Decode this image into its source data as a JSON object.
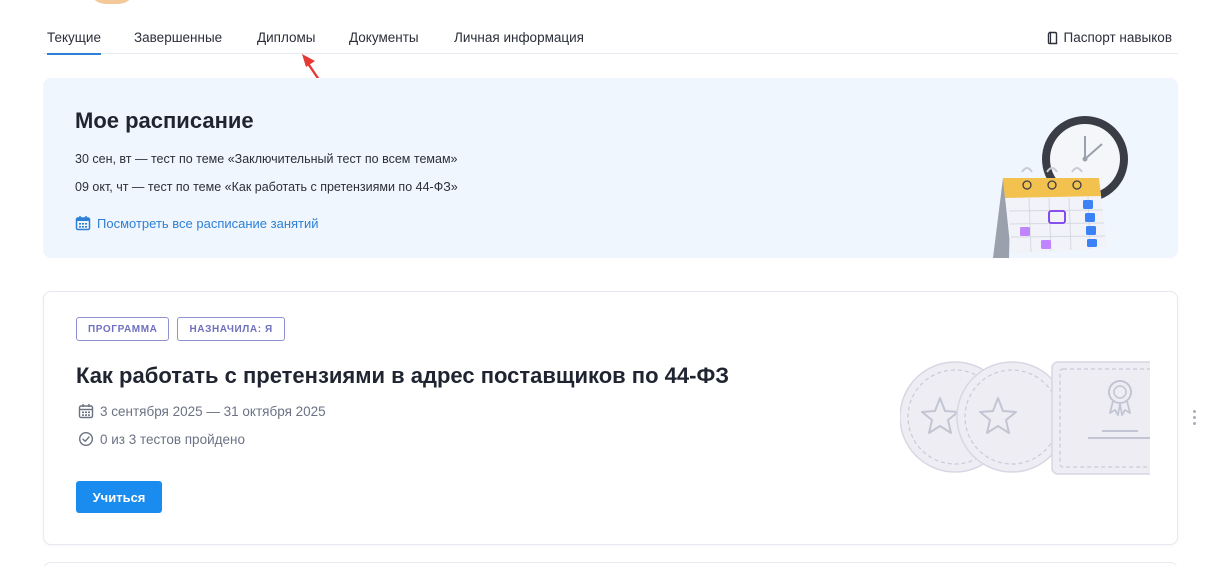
{
  "tabs": [
    {
      "label": "Текущие",
      "active": true
    },
    {
      "label": "Завершенные",
      "active": false
    },
    {
      "label": "Дипломы",
      "active": false
    },
    {
      "label": "Документы",
      "active": false
    },
    {
      "label": "Личная информация",
      "active": false
    }
  ],
  "passport": {
    "label": "Паспорт навыков",
    "icon": "document-icon"
  },
  "schedule": {
    "title": "Мое расписание",
    "items": [
      "30 сен, вт  —  тест по теме  «Заключительный тест по всем темам»",
      "09 окт, чт  —  тест по теме  «Как работать с претензиями по 44-ФЗ»"
    ],
    "link": {
      "label": "Посмотреть все расписание занятий",
      "icon": "calendar-icon"
    }
  },
  "program": {
    "tags": [
      "ПРОГРАММА",
      "НАЗНАЧИЛА: Я"
    ],
    "title": "Как работать с претензиями в адрес поставщиков по 44-ФЗ",
    "dates": "3 сентября 2025 — 31 октября 2025",
    "tests": "0 из 3 тестов пройдено",
    "button": "Учиться"
  },
  "colors": {
    "accent": "#2e7fd6",
    "button": "#1a8cf0",
    "tag": "#6f70bd",
    "schedule_bg": "#eff6fd",
    "arrow": "#e53935"
  }
}
